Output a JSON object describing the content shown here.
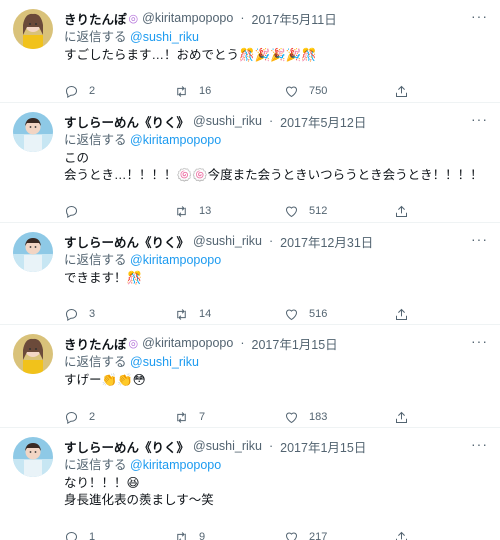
{
  "tweets": [
    {
      "display_name": "きりたんぽ",
      "handle": "@kiritampopopo",
      "date": "2017年5月11日",
      "reply_prefix": "に返信する",
      "reply_to": "@sushi_riku",
      "lines": [
        "すごしたらます…！おめでとう🎊🎉🎉🎉🎊"
      ],
      "replies": "2",
      "retweets": "16",
      "likes": "750",
      "avatar": "girl-yellow"
    },
    {
      "display_name": "すしらーめん《りく》",
      "handle": "@sushi_riku",
      "date": "2017年5月12日",
      "reply_prefix": "に返信する",
      "reply_to": "@kiritampopopo",
      "lines": [
        "この",
        "会うとき…！！！！🍥🍥今度また会うときいつらうとき会うとき！！！！"
      ],
      "replies": "",
      "retweets": "13",
      "likes": "512",
      "avatar": "boy-blue"
    },
    {
      "display_name": "すしらーめん《りく》",
      "handle": "@sushi_riku",
      "date": "2017年12月31日",
      "reply_prefix": "に返信する",
      "reply_to": "@kiritampopopo",
      "lines": [
        "できます！🎊"
      ],
      "replies": "3",
      "retweets": "14",
      "likes": "516",
      "avatar": "boy-blue"
    },
    {
      "display_name": "きりたんぽ",
      "handle": "@kiritampopopo",
      "date": "2017年1月15日",
      "reply_prefix": "に返信する",
      "reply_to": "@sushi_riku",
      "lines": [
        "すげー👏👏😳"
      ],
      "replies": "2",
      "retweets": "7",
      "likes": "183",
      "avatar": "girl-yellow"
    },
    {
      "display_name": "すしらーめん《りく》",
      "handle": "@sushi_riku",
      "date": "2017年1月15日",
      "reply_prefix": "に返信する",
      "reply_to": "@kiritampopopo",
      "lines": [
        "なり！！！😆",
        "身長進化表の羨ましす〜笑"
      ],
      "replies": "1",
      "retweets": "9",
      "likes": "217",
      "avatar": "boy-blue"
    }
  ],
  "icons": {
    "reply": "reply-icon",
    "retweet": "retweet-icon",
    "like": "heart-icon",
    "share": "share-icon",
    "more": "more-icon"
  },
  "colors": {
    "link": "#1d9bf0",
    "secondary": "#536471",
    "text": "#0f1419",
    "divider": "#eff3f4"
  }
}
